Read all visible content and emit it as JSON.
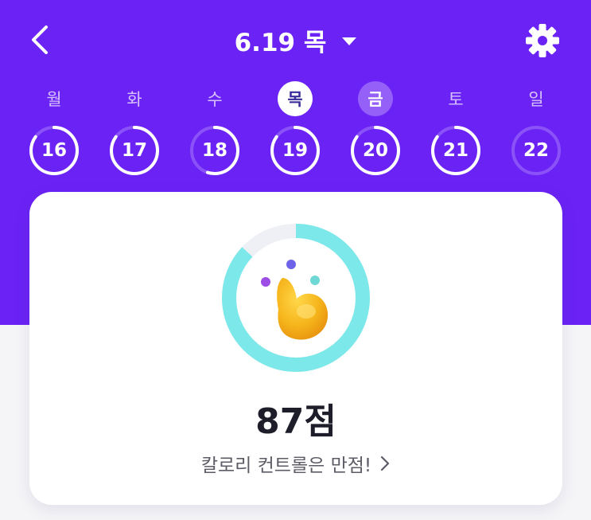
{
  "header": {
    "title_date": "6.19 목",
    "icons": {
      "back": "chevron-left-icon",
      "dropdown": "caret-down-icon",
      "settings": "gear-icon"
    },
    "colors": {
      "background": "#6b23f5",
      "text": "#ffffff"
    }
  },
  "week": {
    "days": [
      {
        "weekday": "월",
        "date": "16",
        "progress": 0.85,
        "state": "normal"
      },
      {
        "weekday": "화",
        "date": "17",
        "progress": 0.85,
        "state": "normal"
      },
      {
        "weekday": "수",
        "date": "18",
        "progress": 0.55,
        "state": "normal"
      },
      {
        "weekday": "목",
        "date": "19",
        "progress": 0.85,
        "state": "selected"
      },
      {
        "weekday": "금",
        "date": "20",
        "progress": 0.85,
        "state": "today"
      },
      {
        "weekday": "토",
        "date": "21",
        "progress": 0.85,
        "state": "normal"
      },
      {
        "weekday": "일",
        "date": "22",
        "progress": 0.0,
        "state": "normal"
      }
    ]
  },
  "score_card": {
    "score_text": "87점",
    "score_progress": 0.87,
    "message": "칼로리 컨트롤은 만점!",
    "icons": {
      "mascot": "mascot-character-icon",
      "arrow": "chevron-right-icon"
    },
    "colors": {
      "ring": "#7de8ea",
      "ring_track": "#eef0f5"
    }
  }
}
